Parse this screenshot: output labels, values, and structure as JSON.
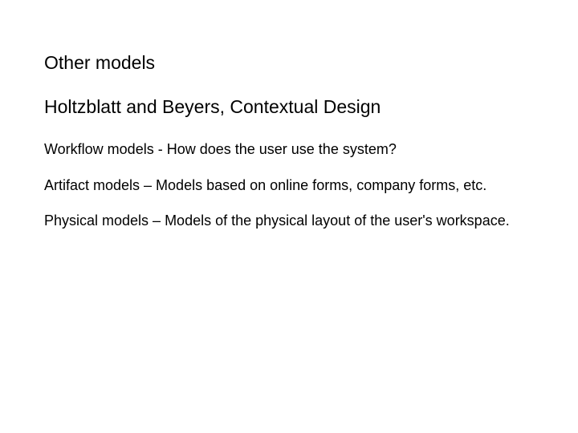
{
  "title": "Other models",
  "subtitle": "Holtzblatt and Beyers,  Contextual Design",
  "paragraphs": [
    "Workflow models -  How does the user use the system?",
    "Artifact models – Models based on online forms, company forms, etc.",
    "Physical models – Models of the physical layout of the user's workspace."
  ]
}
